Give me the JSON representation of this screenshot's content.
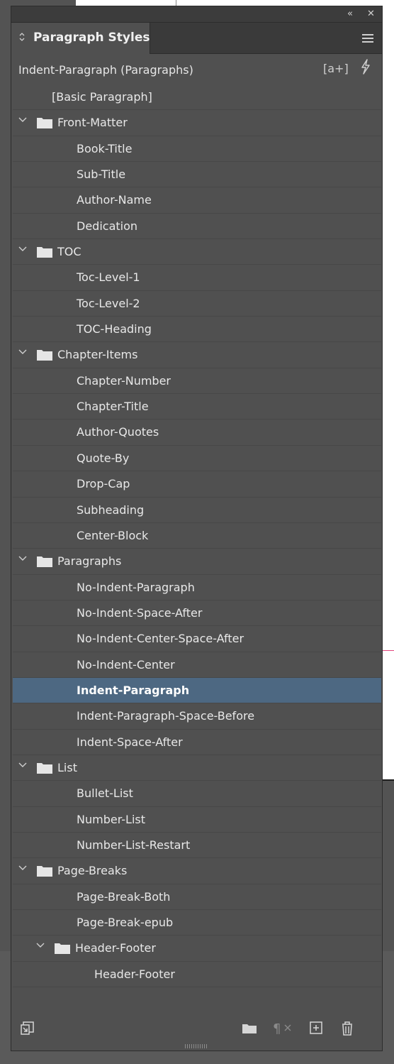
{
  "panel": {
    "collapse_icon": "«",
    "close_icon": "✕",
    "tab_label": "Paragraph Styles",
    "current_style": "Indent-Paragraph (Paragraphs)",
    "new_override_icon": "[a+]"
  },
  "styles": [
    {
      "label": "[Basic Paragraph]",
      "level": 0,
      "type": "style"
    },
    {
      "label": "Front-Matter",
      "level": 0,
      "type": "group"
    },
    {
      "label": "Book-Title",
      "level": 1,
      "type": "style"
    },
    {
      "label": "Sub-Title",
      "level": 1,
      "type": "style"
    },
    {
      "label": "Author-Name",
      "level": 1,
      "type": "style"
    },
    {
      "label": "Dedication",
      "level": 1,
      "type": "style"
    },
    {
      "label": "TOC",
      "level": 0,
      "type": "group"
    },
    {
      "label": "Toc-Level-1",
      "level": 1,
      "type": "style"
    },
    {
      "label": "Toc-Level-2",
      "level": 1,
      "type": "style"
    },
    {
      "label": "TOC-Heading",
      "level": 1,
      "type": "style"
    },
    {
      "label": "Chapter-Items",
      "level": 0,
      "type": "group"
    },
    {
      "label": "Chapter-Number",
      "level": 1,
      "type": "style"
    },
    {
      "label": "Chapter-Title",
      "level": 1,
      "type": "style"
    },
    {
      "label": "Author-Quotes",
      "level": 1,
      "type": "style"
    },
    {
      "label": "Quote-By",
      "level": 1,
      "type": "style"
    },
    {
      "label": "Drop-Cap",
      "level": 1,
      "type": "style"
    },
    {
      "label": "Subheading",
      "level": 1,
      "type": "style"
    },
    {
      "label": "Center-Block",
      "level": 1,
      "type": "style"
    },
    {
      "label": "Paragraphs",
      "level": 0,
      "type": "group"
    },
    {
      "label": "No-Indent-Paragraph",
      "level": 1,
      "type": "style"
    },
    {
      "label": "No-Indent-Space-After",
      "level": 1,
      "type": "style"
    },
    {
      "label": "No-Indent-Center-Space-After",
      "level": 1,
      "type": "style"
    },
    {
      "label": "No-Indent-Center",
      "level": 1,
      "type": "style"
    },
    {
      "label": "Indent-Paragraph",
      "level": 1,
      "type": "style",
      "selected": true
    },
    {
      "label": "Indent-Paragraph-Space-Before",
      "level": 1,
      "type": "style"
    },
    {
      "label": "Indent-Space-After",
      "level": 1,
      "type": "style"
    },
    {
      "label": "List",
      "level": 0,
      "type": "group"
    },
    {
      "label": "Bullet-List",
      "level": 1,
      "type": "style"
    },
    {
      "label": "Number-List",
      "level": 1,
      "type": "style"
    },
    {
      "label": "Number-List-Restart",
      "level": 1,
      "type": "style"
    },
    {
      "label": "Page-Breaks",
      "level": 0,
      "type": "group"
    },
    {
      "label": "Page-Break-Both",
      "level": 1,
      "type": "style"
    },
    {
      "label": "Page-Break-epub",
      "level": 1,
      "type": "style"
    },
    {
      "label": "Header-Footer",
      "level": 1,
      "type": "group"
    },
    {
      "label": "Header-Footer",
      "level": 2,
      "type": "style"
    }
  ],
  "footer_icons": [
    {
      "name": "load-styles-icon",
      "glyph": "⇲",
      "dim": false
    },
    {
      "name": "new-group-icon",
      "glyph": "▬",
      "dim": false
    },
    {
      "name": "clear-overrides-icon",
      "glyph": "¶",
      "dim": true
    },
    {
      "name": "new-style-icon",
      "glyph": "⊞",
      "dim": false
    },
    {
      "name": "delete-style-icon",
      "glyph": "🗑",
      "dim": false
    }
  ],
  "colors": {
    "panel_bg": "#505050",
    "selected_row": "#4d6882",
    "text": "#e8e8e8"
  }
}
